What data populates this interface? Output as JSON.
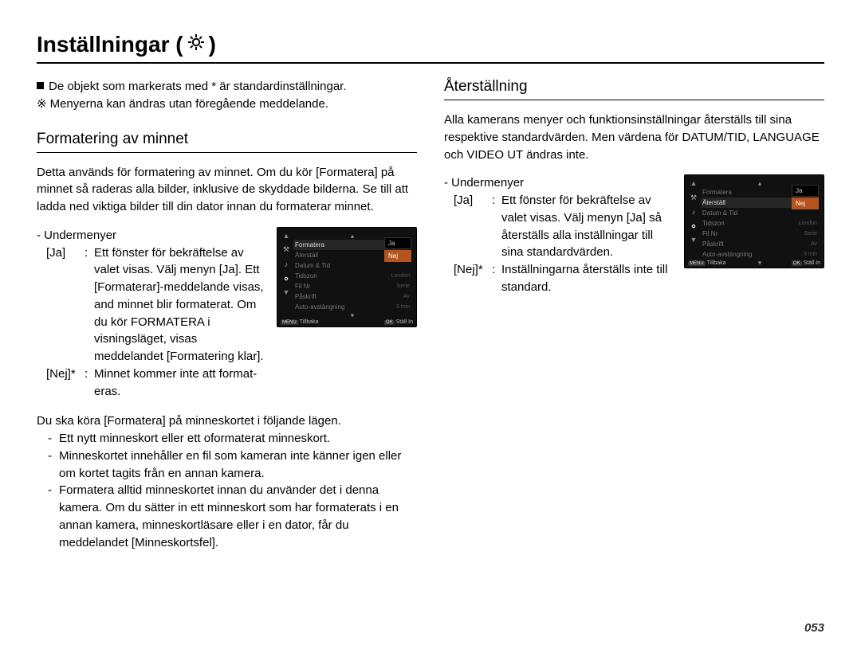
{
  "page_title_prefix": "Inställningar ( ",
  "page_title_suffix": " )",
  "notes": {
    "line1": "De objekt som markerats med * är standardinställningar.",
    "line2": "Menyerna kan ändras utan föregående meddelande."
  },
  "section_format": {
    "heading": "Formatering av minnet",
    "intro": "Detta används för formatering av minnet. Om du kör [Formatera] på minnet så raderas alla bilder, inklusive de skyddade bilderna. Se till att ladda ned viktiga bilder till din dator innan du formaterar minnet.",
    "submenu_label": "- Undermenyer",
    "ja_key": "[Ja]",
    "colon": ":",
    "ja_text": "Ett fönster för bekräftelse av valet visas. Välj menyn [Ja]. Ett [Formaterar]-meddelande visas, and minnet blir formaterat. Om du kör FORMATERA i visningsläget, visas meddelandet [Formatering klar].",
    "nej_key": "[Nej]*",
    "nej_text": "Minnet kommer inte att format­eras.",
    "bullet_lead": "Du ska köra [Formatera] på minneskortet i följande lägen.",
    "bullets": [
      "Ett nytt minneskort eller ett oformaterat minneskort.",
      "Minneskortet innehåller en fil som kameran inte känner igen eller om kortet tagits från en annan kamera.",
      "Formatera alltid minneskortet innan du använder det i denna kamera. Om du sätter in ett minneskort som har formaterats i en annan kamera, minneskortläsare eller i en dator, får du meddelandet [Minneskortsfel]."
    ]
  },
  "section_reset": {
    "heading": "Återställning",
    "intro": "Alla kamerans menyer och funktionsinställningar återställs till sina respektive standardvärden. Men värdena för DATUM/TID, LANGUAGE och VIDEO UT ändras inte.",
    "submenu_label": "- Undermenyer",
    "ja_key": "[Ja]",
    "colon": ":",
    "ja_text": "Ett fönster för bekräftelse av valet visas. Välj menyn [Ja] så återställs alla inställningar till sina standardvärden.",
    "nej_key": "[Nej]*",
    "nej_text": "Inställningarna återställs inte till standard."
  },
  "lcd_format": {
    "items": [
      {
        "l": "Formatera",
        "r": ""
      },
      {
        "l": "Återställ",
        "r": ""
      },
      {
        "l": "Datum & Tid",
        "r": ""
      },
      {
        "l": "Tidszon",
        "r": "London"
      },
      {
        "l": "Fil Nr",
        "r": "Serie"
      },
      {
        "l": "Påskrift",
        "r": "Av"
      },
      {
        "l": "Auto-avstängning",
        "r": "3 min"
      }
    ],
    "opts": [
      "Ja",
      "Nej"
    ],
    "hl_index": 1,
    "sel_index": 0,
    "back_label": "Tillbaka",
    "ok_label": "Ställ In",
    "back_btn": "MENU",
    "ok_btn": "OK"
  },
  "lcd_reset": {
    "items": [
      {
        "l": "Formatera",
        "r": ""
      },
      {
        "l": "Återställ",
        "r": ""
      },
      {
        "l": "Datum & Tid",
        "r": ""
      },
      {
        "l": "Tidszon",
        "r": "London"
      },
      {
        "l": "Fil Nr",
        "r": "Serie"
      },
      {
        "l": "Påskrift",
        "r": "Av"
      },
      {
        "l": "Auto-avstängning",
        "r": "3 min"
      }
    ],
    "opts": [
      "Ja",
      "Nej"
    ],
    "hl_index": 1,
    "sel_index": 1,
    "back_label": "Tillbaka",
    "ok_label": "Ställ In",
    "back_btn": "MENU",
    "ok_btn": "OK"
  },
  "page_number": "053"
}
